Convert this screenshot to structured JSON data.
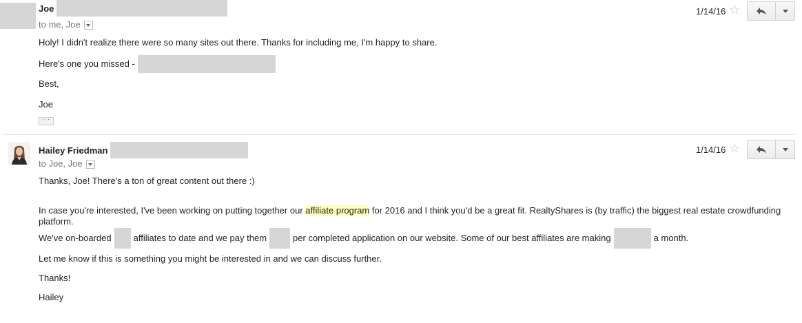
{
  "messages": [
    {
      "sender": "Joe",
      "recipients": "to me, Joe",
      "date": "1/14/16",
      "body": {
        "line1": "Holy! I didn't realize there were so many sites out there. Thanks for including me, I'm happy to share.",
        "line2_prefix": "Here's one you missed -",
        "signoff": "Best,",
        "signature": "Joe"
      },
      "ellipsis": "···"
    },
    {
      "sender": "Hailey Friedman",
      "recipients": "to Joe, Joe",
      "date": "1/14/16",
      "body": {
        "line1": "Thanks, Joe! There's a ton of great content out there :)",
        "p2_before_link": "In case you're interested, I've been working on putting together our",
        "p2_link": "affiliate program",
        "p2_after_link": "for 2016 and I think you'd be a great fit. RealtyShares is (by traffic) the biggest real estate crowdfunding platform.",
        "p3_part1": "We've on-boarded",
        "p3_part2": "affiliates to date and we pay them",
        "p3_part3": "per completed application on our website. Some of our best affiliates are making",
        "p3_part4": "a month.",
        "p4": "Let me know if this is something you might be interested in and we can discuss further.",
        "signoff": "Thanks!",
        "signature": "Hailey"
      }
    }
  ],
  "icons": {
    "star": "star-outline-icon",
    "reply": "reply-arrow-icon",
    "more": "chevron-down-icon"
  },
  "colors": {
    "redaction": "#d6d6d6",
    "link_highlight": "#ffffbb",
    "secondary_text": "#777777"
  }
}
